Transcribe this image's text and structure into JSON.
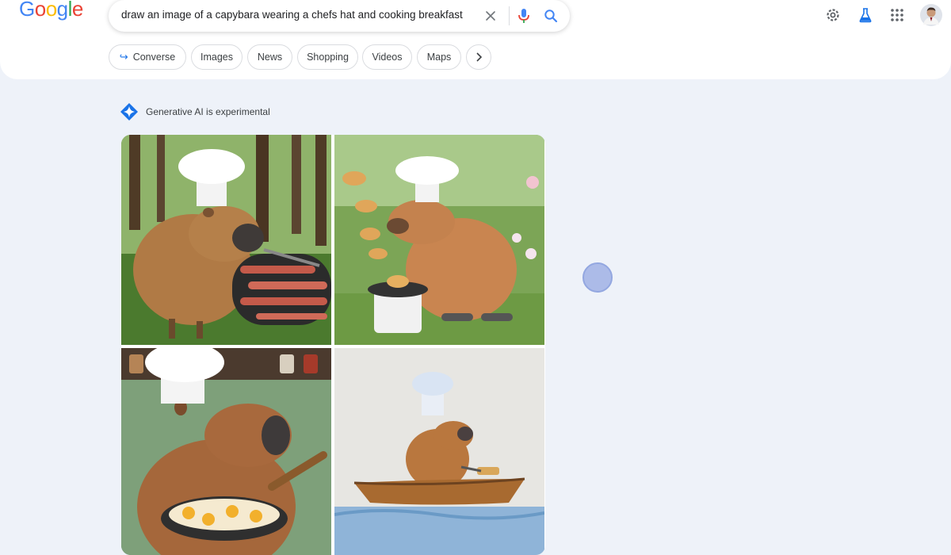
{
  "brand": {
    "logo_letters": [
      "G",
      "o",
      "o",
      "g",
      "l",
      "e"
    ],
    "logo_colors": [
      "#4285f4",
      "#ea4335",
      "#fbbc05",
      "#4285f4",
      "#34a853",
      "#ea4335"
    ]
  },
  "search": {
    "query": "draw an image of a capybara wearing a chefs hat and cooking breakfast",
    "clear_icon": "close-icon",
    "mic_icon": "mic-icon",
    "search_icon": "search-icon"
  },
  "header_actions": {
    "settings_icon": "gear-icon",
    "labs_icon": "flask-icon",
    "apps_icon": "apps-grid-icon",
    "avatar_icon": "avatar"
  },
  "chips": [
    {
      "label": "Converse"
    },
    {
      "label": "Images"
    },
    {
      "label": "News"
    },
    {
      "label": "Shopping"
    },
    {
      "label": "Videos"
    },
    {
      "label": "Maps"
    }
  ],
  "generative": {
    "label": "Generative AI is experimental",
    "accent": "#1a73e8"
  },
  "images": [
    {
      "name": "capybara-grilling-bacon-forest"
    },
    {
      "name": "capybara-flipping-pancakes-garden"
    },
    {
      "name": "capybara-frying-eggs-kitchen"
    },
    {
      "name": "capybara-boat-toast"
    }
  ]
}
